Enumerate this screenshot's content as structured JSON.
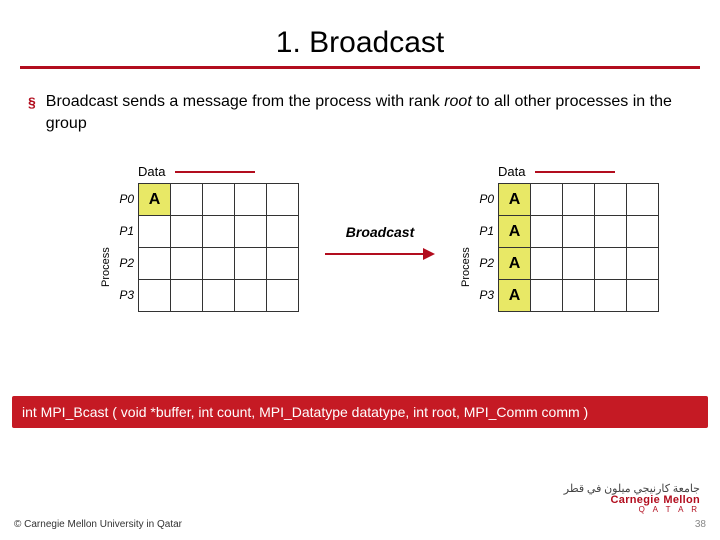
{
  "title": "1. Broadcast",
  "bullet": {
    "html": "Broadcast sends a message from the process with rank <em>root</em> to all other processes in the group"
  },
  "diagram": {
    "data_label": "Data",
    "process_label": "Process",
    "processes": [
      "P0",
      "P1",
      "P2",
      "P3"
    ],
    "cols": 5,
    "value": "A",
    "left_filled_rows": [
      0
    ],
    "right_filled_rows": [
      0,
      1,
      2,
      3
    ],
    "arrow_label": "Broadcast"
  },
  "code": "int MPI_Bcast ( void *buffer, int count, MPI_Datatype datatype, int root, MPI_Comm comm )",
  "footer": {
    "copyright": "© Carnegie Mellon University in Qatar",
    "page": "38",
    "logo_ar": "جامعة كارنيجي ميلون في قطر",
    "logo_en": "Carnegie Mellon",
    "logo_q": "Q A T A R"
  }
}
